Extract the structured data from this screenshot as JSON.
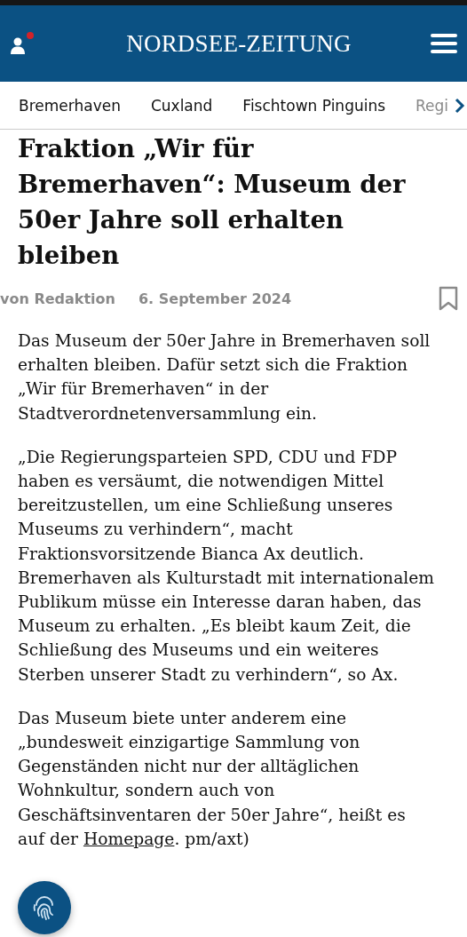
{
  "header": {
    "logo": "NORDSEE-ZEITUNG",
    "notification": true
  },
  "nav": {
    "items": [
      {
        "label": "Bremerhaven"
      },
      {
        "label": "Cuxland"
      },
      {
        "label": "Fischtown Pinguins"
      },
      {
        "label": "Regi"
      }
    ]
  },
  "article": {
    "headline": "Fraktion „Wir für Bremerhaven“: Museum der 50er Jahre soll erhalten bleiben",
    "author": "von Redaktion",
    "date": "6. September 2024",
    "bookmarked": false,
    "paragraphs": [
      [
        {
          "text": "Das Museum der 50er Jahre in Bremerhaven soll erhalten bleiben. Dafür setzt sich die Fraktion „Wir für Bremerhaven“ in der Stadtverordnetenversammlung ein."
        }
      ],
      [
        {
          "text": "„Die Regierungsparteien SPD, CDU und FDP haben es versäumt, die notwendigen Mittel bereitzustellen, um eine Schließung unseres Museums zu verhindern“, macht Fraktionsvorsitzende Bianca Ax deutlich. Bremerhaven als Kulturstadt mit internationalem Publikum müsse ein Interesse daran haben, das Museum zu erhalten. „Es bleibt kaum Zeit, die Schließung des Museums und ein weiteres Sterben unserer Stadt zu verhindern“, so Ax."
        }
      ],
      [
        {
          "text": "Das Museum biete unter anderem eine „bundesweit einzigartige Sammlung von Gegenständen nicht nur der alltäglichen Wohnkultur, sondern auch von Geschäftsinventaren der 50er Jahre“, heißt es auf der "
        },
        {
          "text": "Homepage",
          "kind": "link"
        },
        {
          "text": ". pm/axt)"
        }
      ]
    ]
  }
}
